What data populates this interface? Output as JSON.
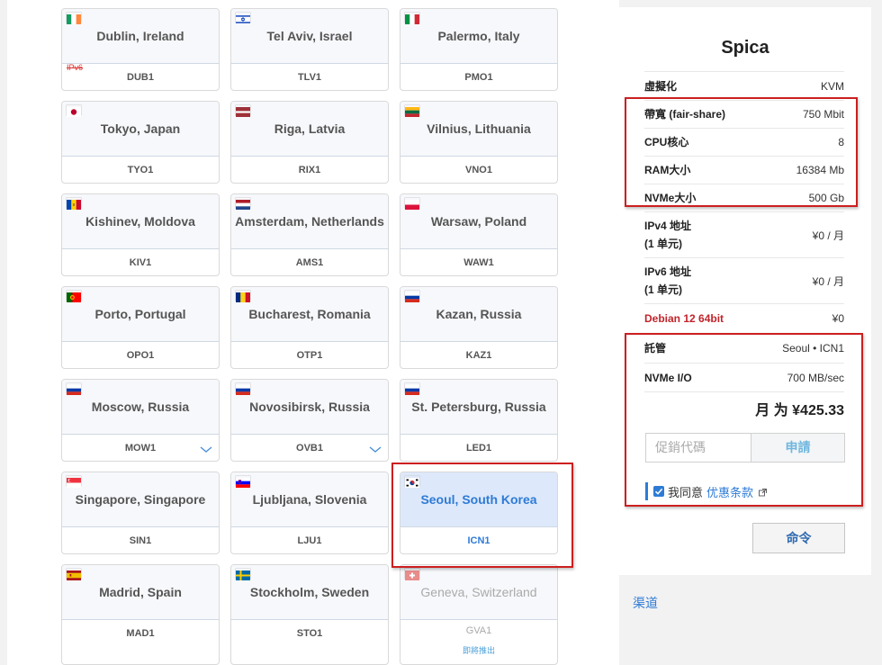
{
  "locations": [
    {
      "city": "Dublin, Ireland",
      "code": "DUB1",
      "flag": "ie",
      "tag": "IPv6"
    },
    {
      "city": "Tel Aviv, Israel",
      "code": "TLV1",
      "flag": "il"
    },
    {
      "city": "Palermo, Italy",
      "code": "PMO1",
      "flag": "it"
    },
    {
      "city": "Tokyo, Japan",
      "code": "TYO1",
      "flag": "jp"
    },
    {
      "city": "Riga, Latvia",
      "code": "RIX1",
      "flag": "lv"
    },
    {
      "city": "Vilnius, Lithuania",
      "code": "VNO1",
      "flag": "lt"
    },
    {
      "city": "Kishinev, Moldova",
      "code": "KIV1",
      "flag": "md"
    },
    {
      "city": "Amsterdam, Netherlands",
      "code": "AMS1",
      "flag": "nl"
    },
    {
      "city": "Warsaw, Poland",
      "code": "WAW1",
      "flag": "pl"
    },
    {
      "city": "Porto, Portugal",
      "code": "OPO1",
      "flag": "pt"
    },
    {
      "city": "Bucharest, Romania",
      "code": "OTP1",
      "flag": "ro"
    },
    {
      "city": "Kazan, Russia",
      "code": "KAZ1",
      "flag": "ru"
    },
    {
      "city": "Moscow, Russia",
      "code": "MOW1",
      "flag": "ru",
      "dropdown": true
    },
    {
      "city": "Novosibirsk, Russia",
      "code": "OVB1",
      "flag": "ru",
      "dropdown": true
    },
    {
      "city": "St. Petersburg, Russia",
      "code": "LED1",
      "flag": "ru"
    },
    {
      "city": "Singapore, Singapore",
      "code": "SIN1",
      "flag": "sg"
    },
    {
      "city": "Ljubljana, Slovenia",
      "code": "LJU1",
      "flag": "si"
    },
    {
      "city": "Seoul, South Korea",
      "code": "ICN1",
      "flag": "kr",
      "selected": true
    },
    {
      "city": "Madrid, Spain",
      "code": "MAD1",
      "flag": "es"
    },
    {
      "city": "Stockholm, Sweden",
      "code": "STO1",
      "flag": "se"
    },
    {
      "city": "Geneva, Switzerland",
      "code": "GVA1",
      "flag": "ch",
      "disabled": true,
      "note": "即將推出"
    }
  ],
  "sidebar": {
    "title": "Spica",
    "specs": [
      {
        "label": "虛擬化",
        "value": "KVM"
      },
      {
        "label": "帶寬 (fair-share)",
        "value": "750 Mbit"
      },
      {
        "label": "CPU核心",
        "value": "8"
      },
      {
        "label": "RAM大小",
        "value": "16384 Mb"
      },
      {
        "label": "NVMe大小",
        "value": "500 Gb"
      },
      {
        "label": "IPv4 地址\n(1 单元)",
        "value": "¥0 / 月"
      },
      {
        "label": "IPv6 地址\n(1 单元)",
        "value": "¥0 / 月"
      },
      {
        "label": "Debian 12 64bit",
        "value": "¥0",
        "red": true
      },
      {
        "label": "託管",
        "value": "Seoul • ICN1"
      },
      {
        "label": "NVMe I/O",
        "value": "700 MB/sec"
      }
    ],
    "total": "月 为 ¥425.33",
    "promo_placeholder": "促銷代碼",
    "apply_label": "申請",
    "agree_text": "我同意",
    "terms_link": "优惠条款",
    "order_label": "命令"
  },
  "channel_link": "渠道"
}
